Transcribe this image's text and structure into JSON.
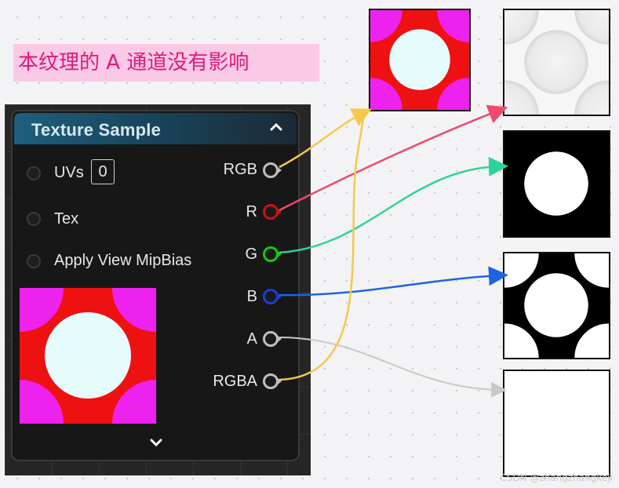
{
  "banner": {
    "text": "本纹理的 A 通道没有影响"
  },
  "node": {
    "title": "Texture Sample",
    "collapse_icon": "chevron-up-icon",
    "expand_icon": "chevron-down-icon",
    "inputs": [
      {
        "label": "UVs",
        "value": "0"
      },
      {
        "label": "Tex"
      },
      {
        "label": "Apply View MipBias"
      }
    ],
    "outputs": [
      {
        "label": "RGB",
        "color": "#bfbfbf"
      },
      {
        "label": "R",
        "color": "#d01010"
      },
      {
        "label": "G",
        "color": "#18c418"
      },
      {
        "label": "B",
        "color": "#1a3fd4"
      },
      {
        "label": "A",
        "color": "#bfbfbf"
      },
      {
        "label": "RGBA",
        "color": "#bfbfbf"
      }
    ]
  },
  "wires": {
    "rgb": "#f2c94c",
    "r": "#ef4a6b",
    "g": "#2fd39a",
    "b": "#1f63e0",
    "a": "#c9c9c9",
    "rgba": "#f2c94c"
  },
  "texture_colors": {
    "red": "#ee1111",
    "magenta": "#ee22ee",
    "center": "#e6fbfb"
  },
  "watermark": "CSDN @zhangzhangkeji"
}
